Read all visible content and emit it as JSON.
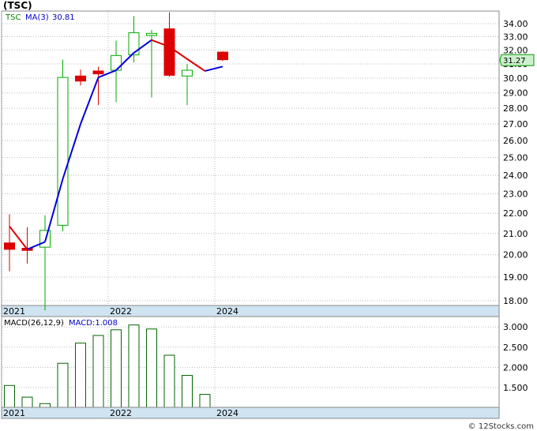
{
  "title": "(TSC)",
  "footer": "© 12Stocks.com",
  "colors": {
    "up": "#00aa00",
    "down": "#dd0000",
    "ma_up": "#0000dd",
    "ma_down": "#dd0000",
    "macd_bar": "#006600",
    "axis_band": "#cfe3f1",
    "grid": "#bbbbbb"
  },
  "chart_data": [
    {
      "type": "candlestick",
      "ticker_label": "TSC",
      "ma_label": "MA(3)",
      "ma_value": "30.81",
      "last_price_label": "31.27",
      "ylim": [
        17.8,
        35.0
      ],
      "y_scale": "log",
      "y_ticks": [
        18.0,
        19.0,
        20.0,
        21.0,
        22.0,
        23.0,
        24.0,
        25.0,
        26.0,
        27.0,
        28.0,
        29.0,
        30.0,
        31.0,
        32.0,
        33.0,
        34.0
      ],
      "y_tick_labels": [
        "18.00",
        "19.00",
        "20.00",
        "21.00",
        "22.00",
        "23.00",
        "24.00",
        "25.00",
        "26.00",
        "27.00",
        "28.00",
        "29.00",
        "30.00",
        "31.00",
        "32.00",
        "33.00",
        "34.00"
      ],
      "x_labels": [
        {
          "label": "2021",
          "index": 0
        },
        {
          "label": "2022",
          "index": 6
        },
        {
          "label": "2024",
          "index": 12
        }
      ],
      "candles": [
        {
          "o": 20.55,
          "h": 21.95,
          "l": 19.25,
          "c": 20.25
        },
        {
          "o": 20.3,
          "h": 21.3,
          "l": 19.6,
          "c": 20.2
        },
        {
          "o": 20.35,
          "h": 21.9,
          "l": 17.6,
          "c": 21.15
        },
        {
          "o": 21.4,
          "h": 31.3,
          "l": 21.1,
          "c": 30.05
        },
        {
          "o": 30.15,
          "h": 30.6,
          "l": 29.5,
          "c": 29.8
        },
        {
          "o": 30.5,
          "h": 30.8,
          "l": 28.2,
          "c": 30.3
        },
        {
          "o": 30.55,
          "h": 32.7,
          "l": 28.4,
          "c": 31.6
        },
        {
          "o": 31.65,
          "h": 34.6,
          "l": 31.1,
          "c": 33.3
        },
        {
          "o": 33.1,
          "h": 33.5,
          "l": 28.7,
          "c": 33.25
        },
        {
          "o": 33.6,
          "h": 34.9,
          "l": 30.1,
          "c": 30.2
        },
        {
          "o": 30.15,
          "h": 31.0,
          "l": 28.2,
          "c": 30.55
        },
        {
          "o": null,
          "h": null,
          "l": null,
          "c": null
        },
        {
          "o": 31.85,
          "h": 31.9,
          "l": 31.2,
          "c": 31.3
        }
      ],
      "ma": [
        21.35,
        20.25,
        20.6,
        23.8,
        27.0,
        30.05,
        30.55,
        31.8,
        32.75,
        32.25,
        31.35,
        30.5,
        30.81
      ]
    },
    {
      "type": "bar",
      "label": "MACD(26,12,9)",
      "value_label": "MACD:1.008",
      "ylim": [
        1.008,
        3.2
      ],
      "y_ticks": [
        1.5,
        2.0,
        2.5,
        3.0
      ],
      "y_tick_labels": [
        "1.500",
        "2.000",
        "2.500",
        "3.000"
      ],
      "x_labels": [
        {
          "label": "2021",
          "index": 0
        },
        {
          "label": "2022",
          "index": 6
        },
        {
          "label": "2024",
          "index": 12
        }
      ],
      "values": [
        1.55,
        1.26,
        1.1,
        2.1,
        2.6,
        2.79,
        2.93,
        3.05,
        2.95,
        2.3,
        1.8,
        1.33,
        null
      ]
    }
  ]
}
